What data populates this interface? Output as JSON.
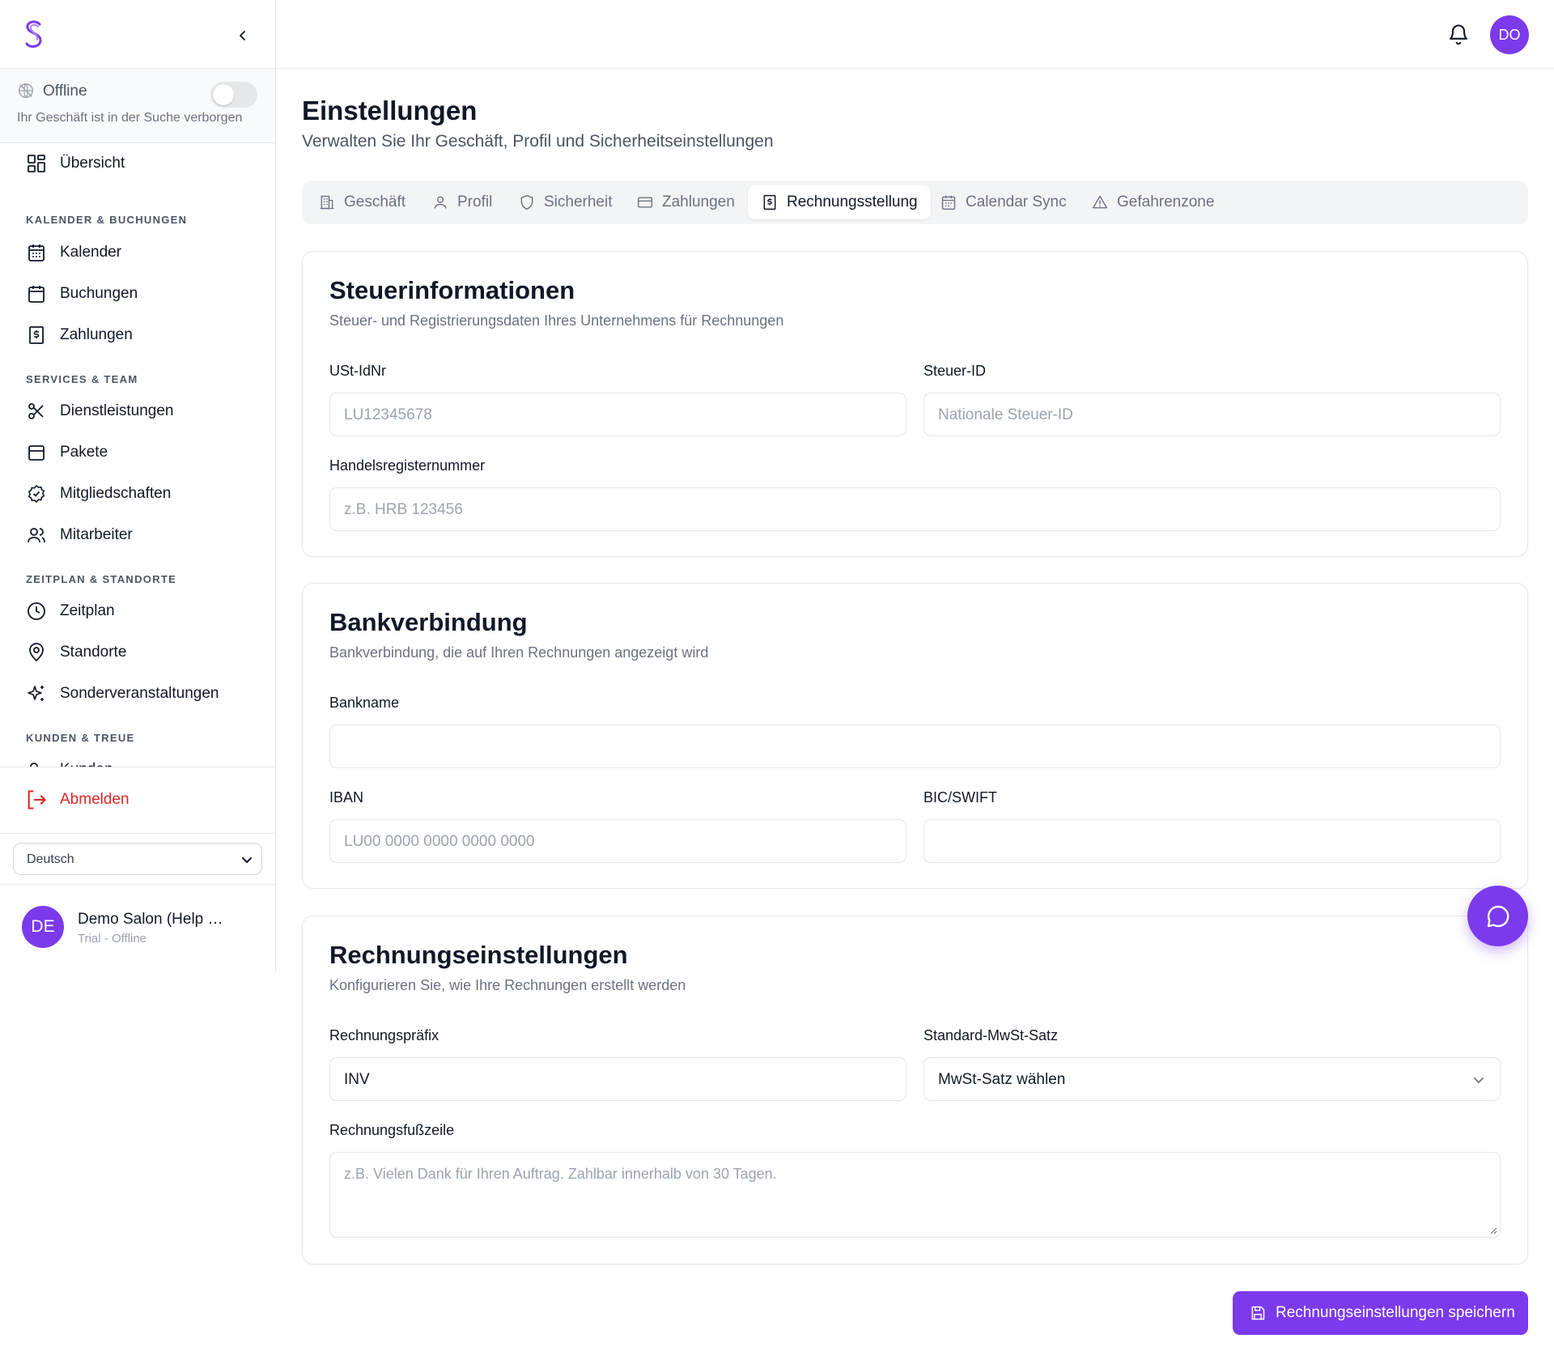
{
  "colors": {
    "accent": "#7c3aed",
    "danger": "#dc2626",
    "border": "#e5e7eb"
  },
  "sidebar": {
    "collapse_icon": "chevron-left-icon",
    "status": {
      "label": "Offline",
      "description": "Ihr Geschäft ist in der Suche verborgen",
      "toggle_on": false
    },
    "overview": {
      "label": "Übersicht",
      "icon": "dashboard-icon"
    },
    "sections": [
      {
        "title": "KALENDER & BUCHUNGEN",
        "items": [
          {
            "label": "Kalender",
            "icon": "calendar-grid-icon"
          },
          {
            "label": "Buchungen",
            "icon": "calendar-icon"
          },
          {
            "label": "Zahlungen",
            "icon": "dollar-receipt-icon"
          }
        ]
      },
      {
        "title": "SERVICES & TEAM",
        "items": [
          {
            "label": "Dienstleistungen",
            "icon": "scissors-icon"
          },
          {
            "label": "Pakete",
            "icon": "package-icon"
          },
          {
            "label": "Mitgliedschaften",
            "icon": "badge-check-icon"
          },
          {
            "label": "Mitarbeiter",
            "icon": "users-icon"
          }
        ]
      },
      {
        "title": "ZEITPLAN & STANDORTE",
        "items": [
          {
            "label": "Zeitplan",
            "icon": "clock-icon"
          },
          {
            "label": "Standorte",
            "icon": "map-pin-icon"
          },
          {
            "label": "Sonderveranstaltungen",
            "icon": "sparkles-icon"
          }
        ]
      },
      {
        "title": "KUNDEN & TREUE",
        "items": [
          {
            "label": "Kunden",
            "icon": "users-icon"
          }
        ]
      }
    ],
    "logout": {
      "label": "Abmelden",
      "icon": "logout-icon"
    },
    "language": {
      "value": "Deutsch"
    },
    "user": {
      "initials": "DE",
      "name": "Demo Salon (Help Center)",
      "subtitle": "Trial - Offline"
    }
  },
  "topbar": {
    "bell_icon": "bell-icon",
    "avatar_initials": "DO"
  },
  "page": {
    "title": "Einstellungen",
    "subtitle": "Verwalten Sie Ihr Geschäft, Profil und Sicherheitseinstellungen"
  },
  "tabs": [
    {
      "label": "Geschäft",
      "icon": "building-icon",
      "active": false
    },
    {
      "label": "Profil",
      "icon": "user-icon",
      "active": false
    },
    {
      "label": "Sicherheit",
      "icon": "shield-icon",
      "active": false
    },
    {
      "label": "Zahlungen",
      "icon": "credit-card-icon",
      "active": false
    },
    {
      "label": "Rechnungsstellung",
      "icon": "invoice-icon",
      "active": true
    },
    {
      "label": "Calendar Sync",
      "icon": "calendar-grid-icon",
      "active": false
    },
    {
      "label": "Gefahrenzone",
      "icon": "warning-icon",
      "active": false
    }
  ],
  "tax": {
    "title": "Steuerinformationen",
    "subtitle": "Steuer- und Registrierungsdaten Ihres Unternehmens für Rechnungen",
    "vat_label": "USt-IdNr",
    "vat_placeholder": "LU12345678",
    "vat_value": "",
    "taxid_label": "Steuer-ID",
    "taxid_placeholder": "Nationale Steuer-ID",
    "taxid_value": "",
    "register_label": "Handelsregisternummer",
    "register_placeholder": "z.B. HRB 123456",
    "register_value": ""
  },
  "bank": {
    "title": "Bankverbindung",
    "subtitle": "Bankverbindung, die auf Ihren Rechnungen angezeigt wird",
    "bankname_label": "Bankname",
    "bankname_placeholder": "",
    "bankname_value": "",
    "iban_label": "IBAN",
    "iban_placeholder": "LU00 0000 0000 0000 0000",
    "iban_value": "",
    "bic_label": "BIC/SWIFT",
    "bic_placeholder": "",
    "bic_value": ""
  },
  "invoice": {
    "title": "Rechnungseinstellungen",
    "subtitle": "Konfigurieren Sie, wie Ihre Rechnungen erstellt werden",
    "prefix_label": "Rechnungspräfix",
    "prefix_value": "INV",
    "vat_rate_label": "Standard-MwSt-Satz",
    "vat_rate_value": "MwSt-Satz wählen",
    "footer_label": "Rechnungsfußzeile",
    "footer_placeholder": "z.B. Vielen Dank für Ihren Auftrag. Zahlbar innerhalb von 30 Tagen."
  },
  "chat_icon": "chat-bubble-icon",
  "save_button": {
    "label": "Rechnungseinstellungen speichern",
    "icon": "save-icon"
  }
}
